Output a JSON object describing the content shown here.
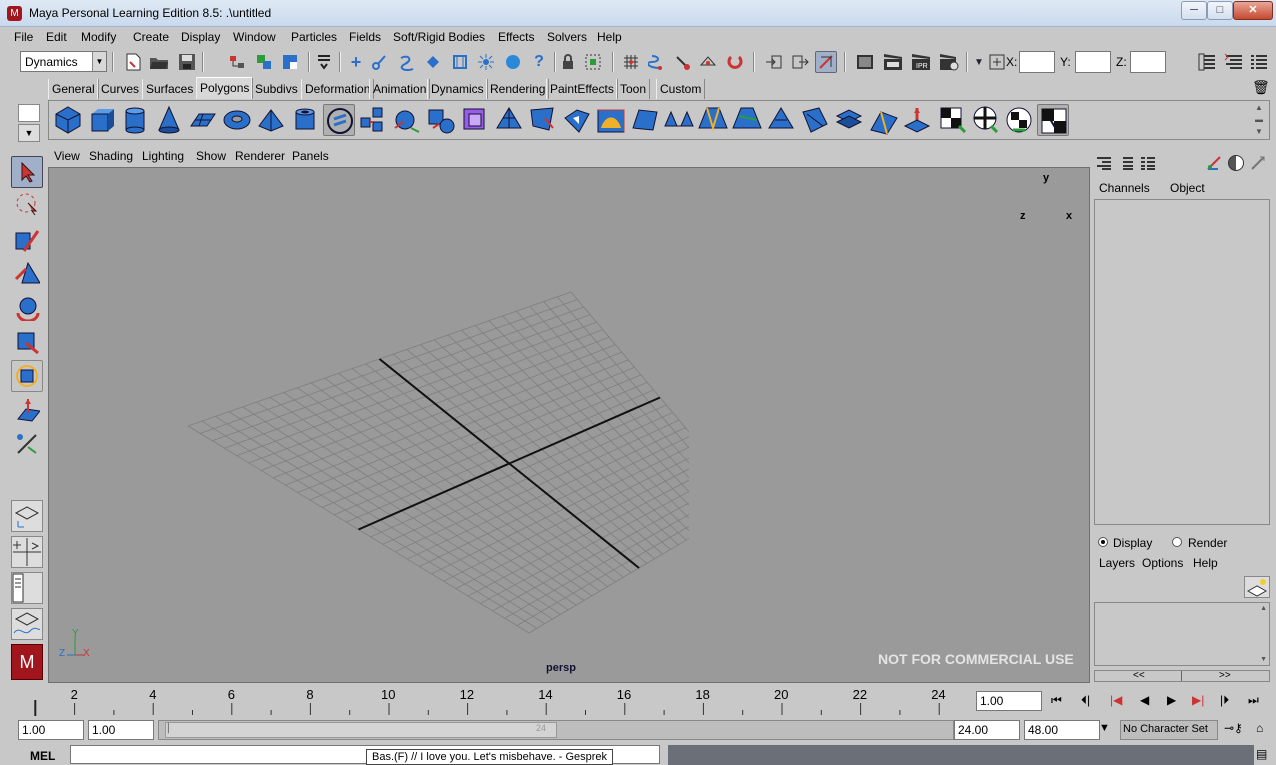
{
  "window": {
    "title": "Maya Personal Learning Edition 8.5: .\\untitled",
    "minimize": "─",
    "maximize": "□",
    "close": "✕"
  },
  "menubar": [
    "File",
    "Edit",
    "Modify",
    "Create",
    "Display",
    "Window",
    "Particles",
    "Fields",
    "Soft/Rigid Bodies",
    "Effects",
    "Solvers",
    "Help"
  ],
  "statusline": {
    "menuset": "Dynamics",
    "x_label": "X:",
    "y_label": "Y:",
    "z_label": "Z:",
    "x_value": "",
    "y_value": "",
    "z_value": ""
  },
  "shelf": {
    "tabs": [
      "General",
      "Curves",
      "Surfaces",
      "Polygons",
      "Subdivs",
      "Deformation",
      "Animation",
      "Dynamics",
      "Rendering",
      "PaintEffects",
      "Toon",
      "Custom"
    ],
    "active_tab": "Polygons"
  },
  "viewport": {
    "menu": [
      "View",
      "Shading",
      "Lighting",
      "Show",
      "Renderer",
      "Panels"
    ],
    "camera_label": "persp",
    "watermark": "NOT FOR COMMERCIAL USE",
    "view_cube": {
      "y": "y",
      "z": "z",
      "x": "x"
    },
    "axis": {
      "y": "Y",
      "z": "Z",
      "x": "X"
    }
  },
  "channel_box": {
    "menu": [
      "Channels",
      "Object"
    ],
    "layer_mode_display": "Display",
    "layer_mode_render": "Render",
    "layer_menu": [
      "Layers",
      "Options",
      "Help"
    ],
    "scroll_left": "<<",
    "scroll_right": ">>"
  },
  "timeline": {
    "ticks": [
      "2",
      "4",
      "6",
      "8",
      "10",
      "12",
      "14",
      "16",
      "18",
      "20",
      "22",
      "24"
    ],
    "current_time": "1.00"
  },
  "range": {
    "start": "1.00",
    "playback_start": "1.00",
    "slider_end_label": "24",
    "playback_end": "24.00",
    "end": "48.00",
    "character_set": "No Character Set"
  },
  "command": {
    "label": "MEL",
    "tooltip": "Bas.(F) //  I love you. Let's misbehave. - Gesprek"
  },
  "colors": {
    "ui_bg": "#c8c8c8",
    "viewport_bg": "#9a9a9a",
    "grid": "#7f7f7f",
    "axis_line": "#111111",
    "icon_blue": "#2a6fc9",
    "selected_tool": "#9fb0c8"
  }
}
